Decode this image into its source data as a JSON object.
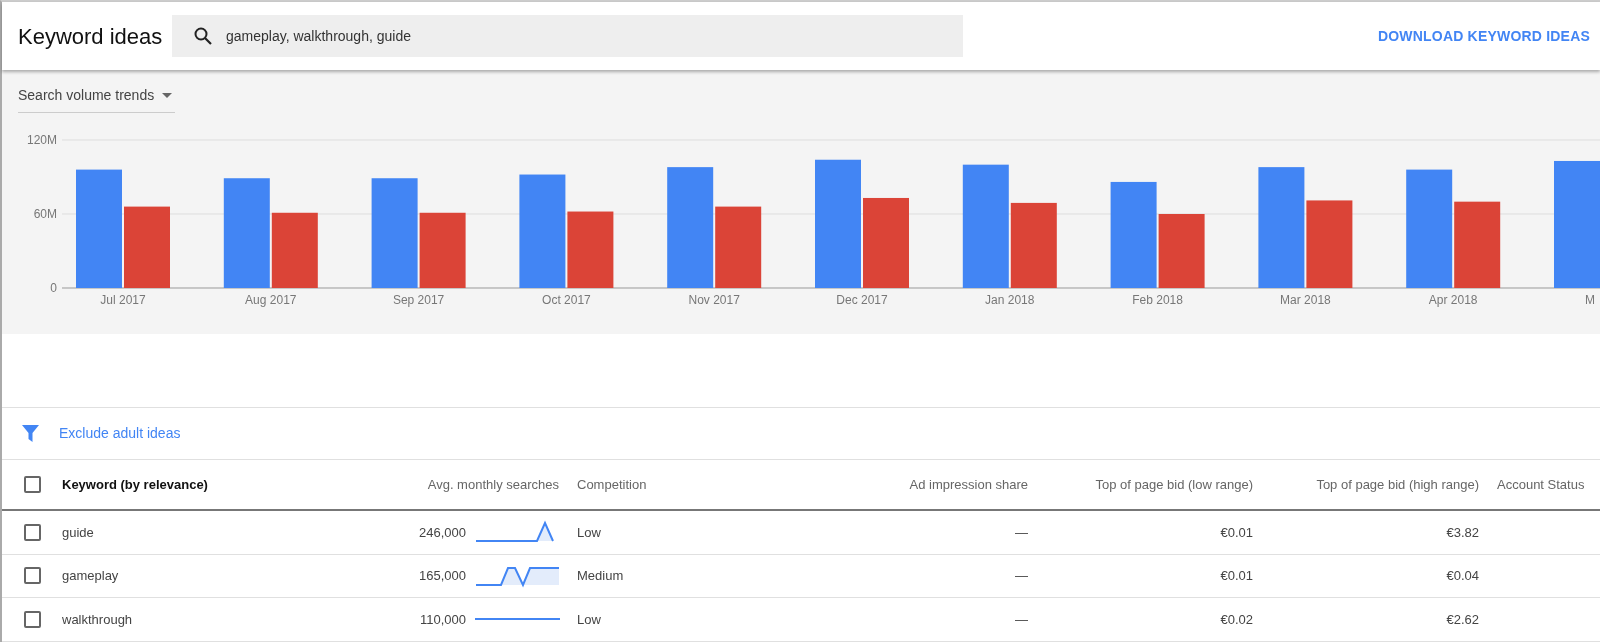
{
  "header": {
    "title": "Keyword ideas",
    "search": {
      "value": "gameplay, walkthrough, guide"
    },
    "download_link": "DOWNLOAD KEYWORD IDEAS"
  },
  "trends": {
    "dropdown": "Search volume trends",
    "chart_data": {
      "type": "bar",
      "categories": [
        "Jul 2017",
        "Aug 2017",
        "Sep 2017",
        "Oct 2017",
        "Nov 2017",
        "Dec 2017",
        "Jan 2018",
        "Feb 2018",
        "Mar 2018",
        "Apr 2018",
        "M"
      ],
      "ylim": [
        0,
        120000000
      ],
      "yticks": [
        {
          "value": 0,
          "label": "0"
        },
        {
          "value": 60000000,
          "label": "60M"
        },
        {
          "value": 120000000,
          "label": "120M"
        }
      ],
      "series": [
        {
          "color": "#4285f4",
          "values": [
            96000000,
            89000000,
            89000000,
            92000000,
            98000000,
            104000000,
            100000000,
            86000000,
            98000000,
            96000000,
            103000000
          ]
        },
        {
          "color": "#db4437",
          "values": [
            66000000,
            61000000,
            61000000,
            62000000,
            66000000,
            73000000,
            69000000,
            60000000,
            71000000,
            70000000,
            null
          ]
        }
      ]
    }
  },
  "filter": {
    "link": "Exclude adult ideas"
  },
  "table": {
    "select_all": {
      "checked": false
    },
    "columns": [
      "Keyword (by relevance)",
      "Avg. monthly searches",
      "Competition",
      "Ad impression share",
      "Top of page bid (low range)",
      "Top of page bid (high range)",
      "Account Status"
    ],
    "rows": [
      {
        "checked": false,
        "keyword": "guide",
        "searches": "246,000",
        "kind": "spike",
        "competition": "Low",
        "impression_share": "—",
        "bid_low": "€0.01",
        "bid_high": "€3.82"
      },
      {
        "checked": false,
        "keyword": "gameplay",
        "searches": "165,000",
        "kind": "dip",
        "competition": "Medium",
        "impression_share": "—",
        "bid_low": "€0.01",
        "bid_high": "€0.04"
      },
      {
        "checked": false,
        "keyword": "walkthrough",
        "searches": "110,000",
        "kind": "flat",
        "competition": "Low",
        "impression_share": "—",
        "bid_low": "€0.02",
        "bid_high": "€2.62"
      }
    ]
  }
}
